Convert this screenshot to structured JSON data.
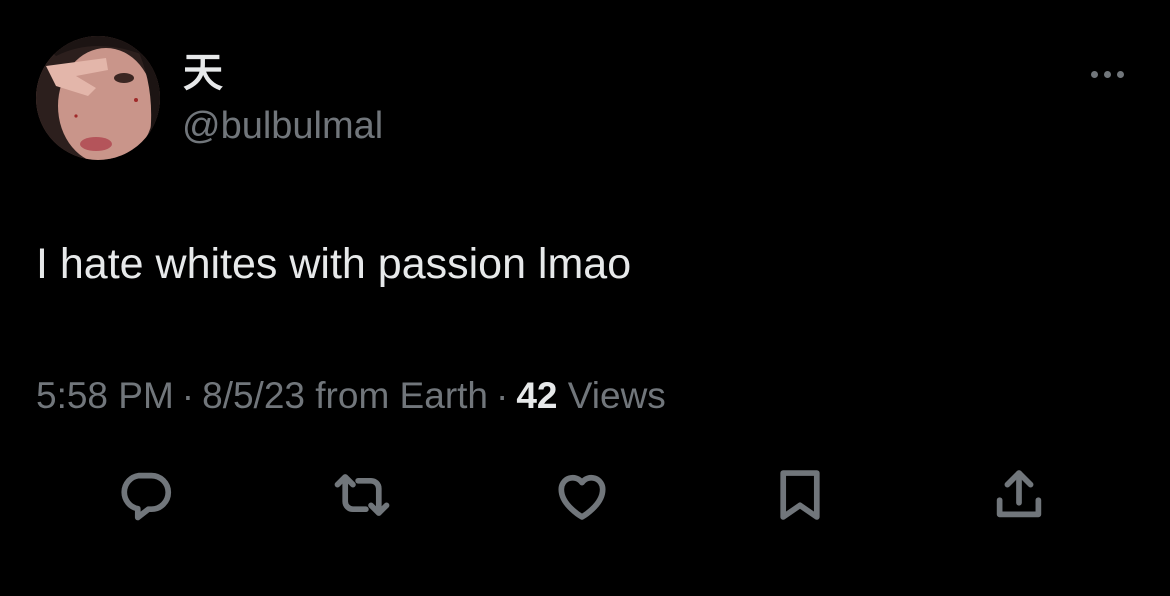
{
  "tweet": {
    "author": {
      "display_name": "天",
      "handle": "@bulbulmal",
      "avatar": "profile-photo"
    },
    "text": "I hate whites with passion lmao",
    "meta": {
      "time": "5:58 PM",
      "date": "8/5/23",
      "source": "from Earth",
      "separator": "·",
      "views_count": "42",
      "views_label": "Views"
    },
    "more_icon": "more-horizontal-icon",
    "actions": [
      {
        "name": "reply",
        "icon": "reply-icon"
      },
      {
        "name": "retweet",
        "icon": "retweet-icon"
      },
      {
        "name": "like",
        "icon": "heart-icon"
      },
      {
        "name": "bookmark",
        "icon": "bookmark-icon"
      },
      {
        "name": "share",
        "icon": "share-icon"
      }
    ]
  },
  "colors": {
    "background": "#000000",
    "primary_text": "#e7e9ea",
    "secondary_text": "#71767b"
  }
}
